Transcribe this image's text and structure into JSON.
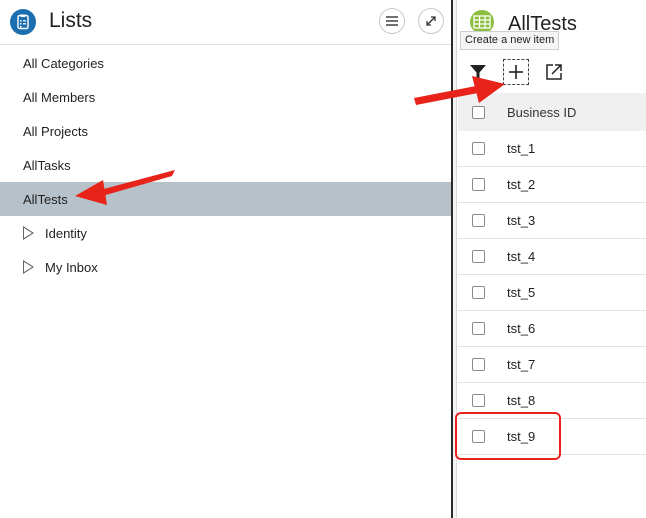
{
  "left": {
    "title": "Lists",
    "nav_items": [
      {
        "label": "All Categories"
      },
      {
        "label": "All Members"
      },
      {
        "label": "All Projects"
      },
      {
        "label": "AllTasks"
      },
      {
        "label": "AllTests",
        "selected": true
      },
      {
        "label": "Identity",
        "expandable": true
      },
      {
        "label": "My Inbox",
        "expandable": true
      }
    ]
  },
  "right": {
    "title": "AllTests",
    "tooltip": "Create a new item",
    "column_header": "Business ID",
    "rows": [
      "tst_1",
      "tst_2",
      "tst_3",
      "tst_4",
      "tst_5",
      "tst_6",
      "tst_7",
      "tst_8",
      "tst_9"
    ]
  },
  "colors": {
    "selection": "#b7c1c9",
    "annotation_red": "#e8231a",
    "lists_icon": "#1b6fb0",
    "alltests_icon": "#8dbf3f"
  },
  "icons": [
    "lists-app-icon",
    "menu-icon",
    "expand-icon",
    "alltests-app-icon",
    "filter-icon",
    "plus-icon",
    "open-external-icon",
    "expand-triangle-icon"
  ]
}
